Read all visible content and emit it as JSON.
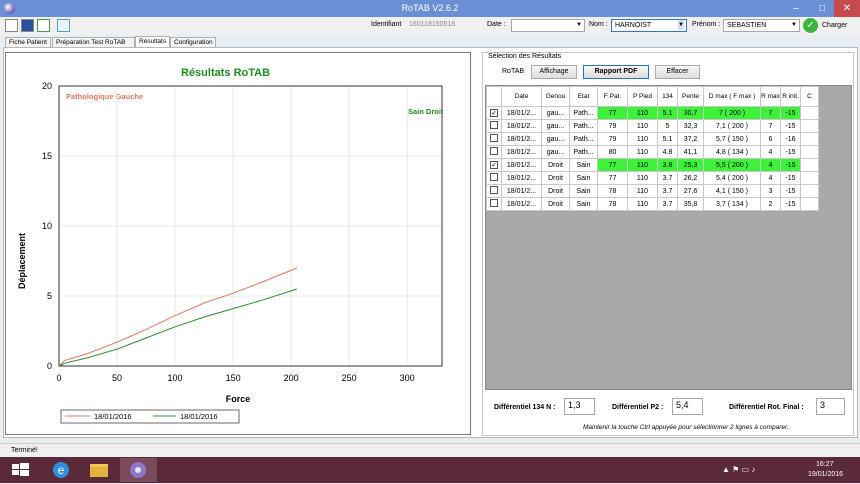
{
  "window": {
    "title": "RoTAB V2.6.2",
    "min": "–",
    "max": "□",
    "close": "✕"
  },
  "toolbar": {
    "identifiant_label": "Identifiant",
    "identifiant_value": "160118150518",
    "date_label": "Date :",
    "date_value": "",
    "nom_label": "Nom :",
    "nom_value": "HARNOIST",
    "prenom_label": "Prénom :",
    "prenom_value": "SEBASTIEN",
    "charger_label": "Charger"
  },
  "tabs": [
    "Fiche Patient",
    "Préparation Test RoTAB",
    "Résultats",
    "Configuration"
  ],
  "chart_data": {
    "type": "line",
    "title": "Résultats RoTAB",
    "xlabel": "Force",
    "ylabel": "Déplacement",
    "xlim": [
      0,
      330
    ],
    "ylim": [
      0,
      20
    ],
    "xticks": [
      0,
      50,
      100,
      150,
      200,
      250,
      300
    ],
    "yticks": [
      0,
      5,
      10,
      15,
      20
    ],
    "annotations": [
      "Pathologique Gauche",
      "Sain Droit"
    ],
    "series": [
      {
        "name": "18/01/2016",
        "color": "#e07860",
        "x": [
          0,
          5,
          25,
          50,
          75,
          100,
          125,
          150,
          175,
          205
        ],
        "y": [
          0,
          0.4,
          0.9,
          1.7,
          2.6,
          3.6,
          4.5,
          5.2,
          6.0,
          7.0
        ]
      },
      {
        "name": "18/01/2016",
        "color": "#2e8b2e",
        "x": [
          0,
          5,
          25,
          50,
          75,
          100,
          125,
          150,
          175,
          205
        ],
        "y": [
          0,
          0.2,
          0.6,
          1.2,
          2.0,
          2.8,
          3.5,
          4.1,
          4.7,
          5.5
        ]
      }
    ]
  },
  "results": {
    "section_title": "Sélection des Résultats",
    "rotab_tab": "RoTAB",
    "affichage_btn": "Affichage",
    "rapport_btn": "Rapport PDF",
    "effacer_btn": "Effacer",
    "headers": [
      "Date",
      "Genou",
      "Etat",
      "F Pat.",
      "P Pied",
      "134",
      "Pente",
      "D max ( F max )",
      "R max",
      "R init.",
      "C"
    ],
    "rows": [
      {
        "checked": true,
        "date": "18/01/2...",
        "genou": "gau...",
        "etat": "Path...",
        "fpat": "77",
        "ppied": "110",
        "c134": "5.1",
        "pente": "30,7",
        "dmax": "7 ( 200 )",
        "rmax": "7",
        "rinit": "-15",
        "c": ""
      },
      {
        "checked": false,
        "date": "18/01/2...",
        "genou": "gau...",
        "etat": "Path...",
        "fpat": "79",
        "ppied": "110",
        "c134": "5",
        "pente": "32,3",
        "dmax": "7,1 ( 200 )",
        "rmax": "7",
        "rinit": "-15",
        "c": ""
      },
      {
        "checked": false,
        "date": "18/01/2...",
        "genou": "gau...",
        "etat": "Path...",
        "fpat": "79",
        "ppied": "110",
        "c134": "5.1",
        "pente": "37,2",
        "dmax": "5,7 ( 150 )",
        "rmax": "6",
        "rinit": "-16",
        "c": ""
      },
      {
        "checked": false,
        "date": "18/01/2...",
        "genou": "gau...",
        "etat": "Path...",
        "fpat": "80",
        "ppied": "110",
        "c134": "4.8",
        "pente": "41,1",
        "dmax": "4,8 ( 134 )",
        "rmax": "4",
        "rinit": "-15",
        "c": ""
      },
      {
        "checked": true,
        "date": "18/01/2...",
        "genou": "Droit",
        "etat": "Sain",
        "fpat": "77",
        "ppied": "110",
        "c134": "3.8",
        "pente": "25,3",
        "dmax": "5,5 ( 200 )",
        "rmax": "4",
        "rinit": "-15",
        "c": ""
      },
      {
        "checked": false,
        "date": "18/01/2...",
        "genou": "Droit",
        "etat": "Sain",
        "fpat": "77",
        "ppied": "110",
        "c134": "3.7",
        "pente": "26,2",
        "dmax": "5,4 ( 200 )",
        "rmax": "4",
        "rinit": "-15",
        "c": ""
      },
      {
        "checked": false,
        "date": "18/01/2...",
        "genou": "Droit",
        "etat": "Sain",
        "fpat": "78",
        "ppied": "110",
        "c134": "3.7",
        "pente": "27,6",
        "dmax": "4,1 ( 150 )",
        "rmax": "3",
        "rinit": "-15",
        "c": ""
      },
      {
        "checked": false,
        "date": "18/01/2...",
        "genou": "Droit",
        "etat": "Sain",
        "fpat": "78",
        "ppied": "110",
        "c134": "3.7",
        "pente": "35,8",
        "dmax": "3,7 ( 134 )",
        "rmax": "2",
        "rinit": "-15",
        "c": ""
      }
    ],
    "diff134_label": "Différentiel 134 N :",
    "diff134_value": "1,3",
    "diffp2_label": "Différentiel P2 :",
    "diffp2_value": "5,4",
    "diffrot_label": "Différentiel Rot. Final :",
    "diffrot_value": "3",
    "hint": "Maintenir la touche Ctrl appuyée pour sélectionner 2 lignes à comparer."
  },
  "status": "Terminé!",
  "taskbar": {
    "time": "16:27",
    "date": "19/01/2016"
  },
  "colors": {
    "titlebar": "#6a8fd6",
    "selected_row": "#3ef23a",
    "taskbar": "#5b2a3a"
  }
}
